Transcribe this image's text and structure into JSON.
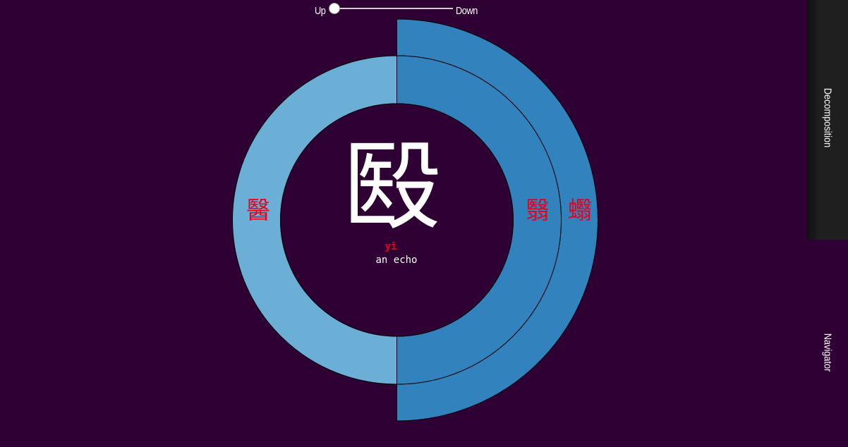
{
  "slider": {
    "up_label": "Up",
    "down_label": "Down",
    "position": 0
  },
  "center": {
    "character": "殹",
    "pinyin": "yī",
    "definition": "an echo"
  },
  "rings": {
    "inner_left": {
      "character": "醫",
      "color": "#6baed6"
    },
    "inner_right": {
      "character": "翳",
      "color": "#3182bd"
    },
    "outer_right": {
      "character": "蠮",
      "color": "#3182bd"
    }
  },
  "colors": {
    "background": "#2f0033",
    "accent_text": "#e8001c",
    "center_text": "#ffffff"
  },
  "side_panels": {
    "decomposition_label": "Decomposition",
    "navigator_label": "Navigator"
  }
}
